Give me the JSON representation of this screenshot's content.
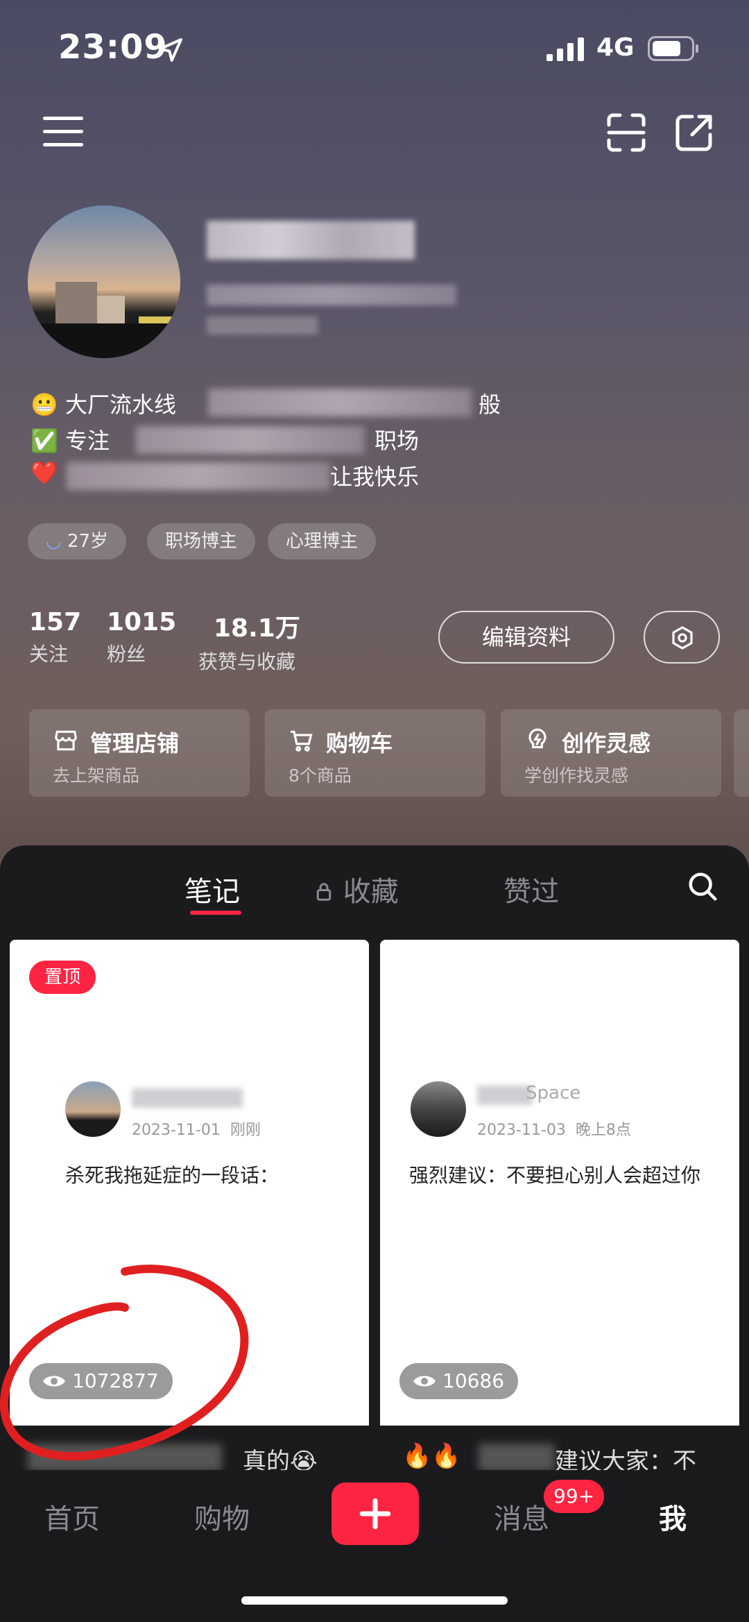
{
  "status_bar": {
    "time": "23:09",
    "network": "4G"
  },
  "profile": {
    "bio": [
      "😬 大厂流水线",
      "✅ 专注",
      "❤️",
      "让我快乐"
    ],
    "bio_tail": [
      "般",
      "职场"
    ],
    "tags": [
      "27岁",
      "职场博主",
      "心理博主"
    ],
    "stats": [
      {
        "value": "157",
        "label": "关注"
      },
      {
        "value": "1015",
        "label": "粉丝"
      },
      {
        "value": "18.1万",
        "label": "获赞与收藏"
      }
    ],
    "edit_label": "编辑资料"
  },
  "cards": [
    {
      "title": "管理店铺",
      "sub": "去上架商品",
      "icon": "store-icon"
    },
    {
      "title": "购物车",
      "sub": "8个商品",
      "icon": "cart-icon"
    },
    {
      "title": "创作灵感",
      "sub": "学创作找灵感",
      "icon": "bulb-icon"
    }
  ],
  "tabs": [
    "笔记",
    "收藏",
    "赞过"
  ],
  "notes": [
    {
      "pin": "置顶",
      "date": "2023-11-01",
      "time": "刚刚",
      "text": "杀死我拖延症的一段话：",
      "views": "1072877",
      "bottom_text": "真的😭"
    },
    {
      "author_suffix": "Space",
      "date": "2023-11-03",
      "time": "晚上8点",
      "text": "强烈建议：不要担心别人会超过你",
      "views": "10686",
      "bottom_text": "🔥🔥",
      "bottom_tail": "建议大家：不"
    }
  ],
  "bottom_nav": {
    "items": [
      "首页",
      "购物",
      "消息",
      "我"
    ],
    "badge": "99+"
  }
}
